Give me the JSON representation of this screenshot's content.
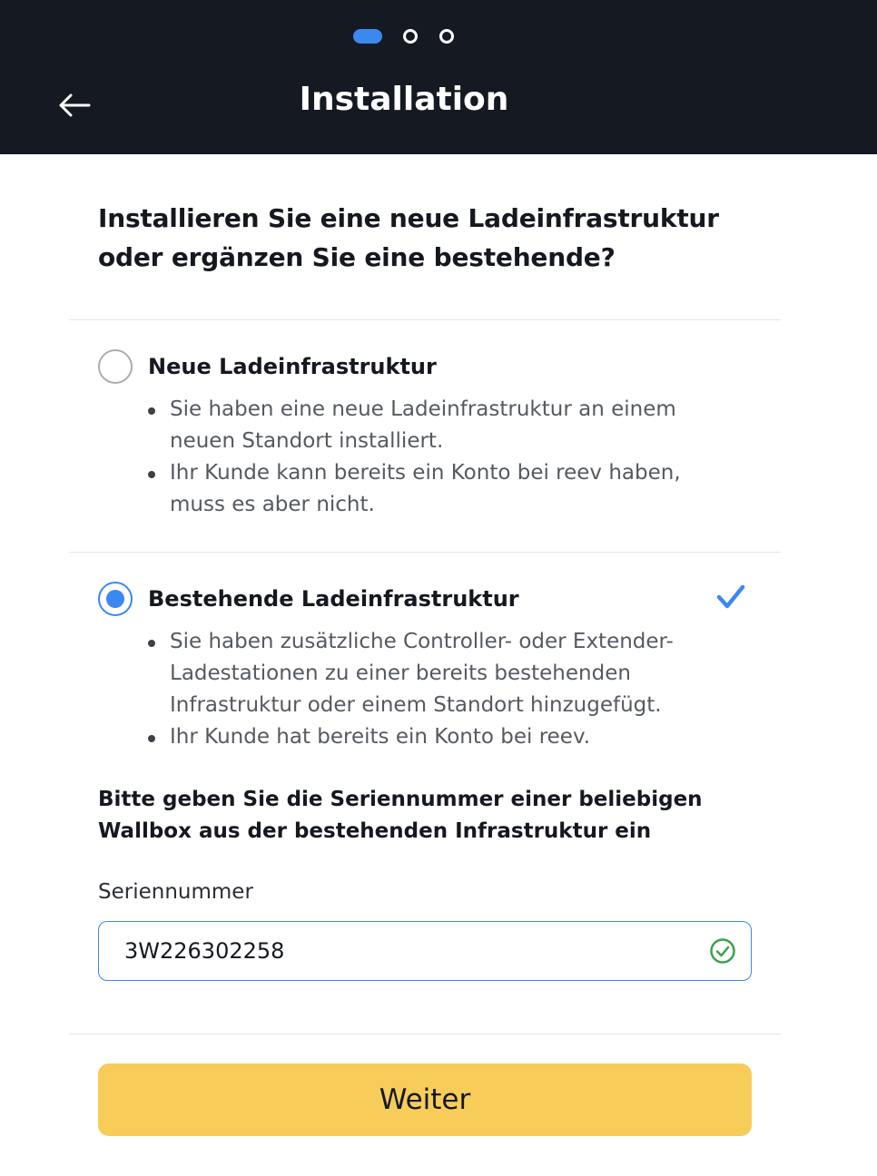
{
  "header": {
    "title": "Installation",
    "steps_total": 3,
    "active_step": 1
  },
  "question": "Installieren Sie eine neue Ladeinfrastruktur oder ergänzen Sie eine bestehende?",
  "options": [
    {
      "title": "Neue Ladeinfrastruktur",
      "selected": false,
      "bullets": [
        "Sie haben eine neue Ladeinfrastruktur an einem neuen Standort installiert.",
        "Ihr Kunde kann bereits ein Konto bei reev haben, muss es aber nicht."
      ]
    },
    {
      "title": "Bestehende Ladeinfrastruktur",
      "selected": true,
      "bullets": [
        "Sie haben zusätzliche Controller- oder Extender-Ladestationen zu einer bereits bestehenden Infrastruktur oder einem Standort hinzugefügt.",
        "Ihr Kunde hat bereits ein Konto bei reev."
      ]
    }
  ],
  "serial": {
    "prompt": "Bitte geben Sie die Seriennummer einer beliebigen Wallbox aus der bestehenden Infrastruktur ein",
    "label": "Seriennummer",
    "value": "3W226302258",
    "valid": true
  },
  "primary_button": {
    "label": "Weiter"
  },
  "colors": {
    "header_bg": "#141922",
    "accent": "#3b88f0",
    "button_bg": "#f7cc58",
    "valid_green": "#3aa24a"
  },
  "icons": {
    "back": "arrow-left-icon",
    "selected": "checkmark-icon",
    "valid": "check-circle-icon"
  }
}
